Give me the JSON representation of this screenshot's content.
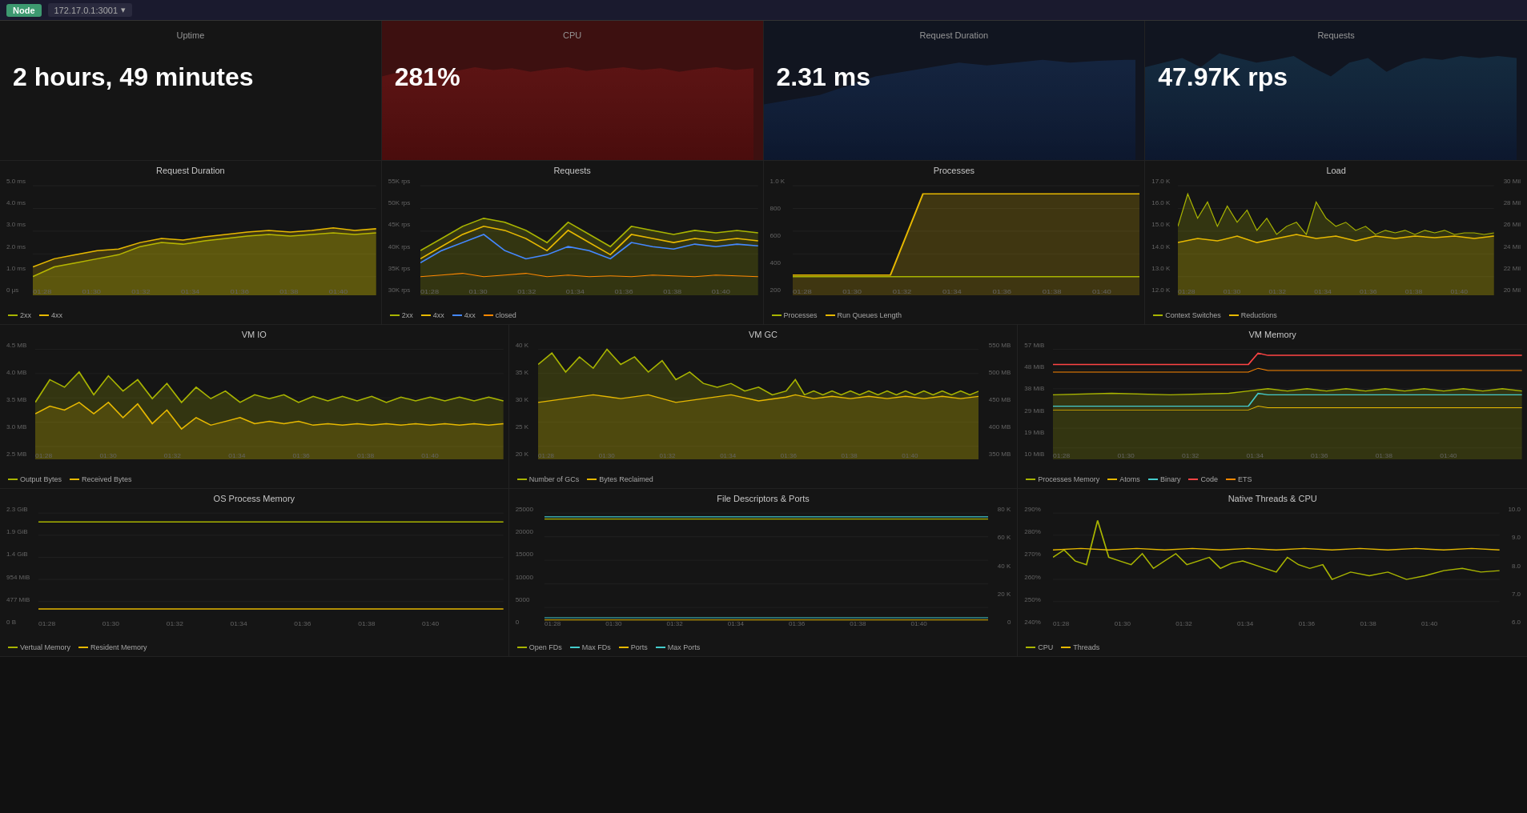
{
  "topbar": {
    "node_label": "Node",
    "address": "172.17.0.1:3001",
    "dropdown_arrow": "▾"
  },
  "summary": {
    "uptime": {
      "title": "Uptime",
      "value": "2 hours, 49 minutes"
    },
    "cpu": {
      "title": "CPU",
      "value": "281%"
    },
    "request_duration": {
      "title": "Request Duration",
      "value": "2.31 ms"
    },
    "requests": {
      "title": "Requests",
      "value": "47.97K rps"
    }
  },
  "charts_row1": {
    "request_duration": {
      "title": "Request Duration",
      "yaxis": [
        "5.0 ms",
        "4.0 ms",
        "3.0 ms",
        "2.0 ms",
        "1.0 ms",
        "0 μs"
      ],
      "xaxis": [
        "01:28",
        "01:30",
        "01:32",
        "01:34",
        "01:36",
        "01:38",
        "01:40"
      ],
      "legend": [
        {
          "label": "2xx",
          "color": "#a8b400"
        },
        {
          "label": "4xx",
          "color": "#e6b800"
        }
      ]
    },
    "requests": {
      "title": "Requests",
      "yaxis": [
        "55K rps",
        "50K rps",
        "45K rps",
        "40K rps",
        "35K rps",
        "30K rps"
      ],
      "xaxis": [
        "01:28",
        "01:30",
        "01:32",
        "01:34",
        "01:36",
        "01:38",
        "01:40"
      ],
      "legend": [
        {
          "label": "2xx",
          "color": "#a8b400"
        },
        {
          "label": "4xx",
          "color": "#e6b800"
        },
        {
          "label": "4xx",
          "color": "#4488ff"
        },
        {
          "label": "closed",
          "color": "#ff8800"
        }
      ]
    },
    "processes": {
      "title": "Processes",
      "yaxis": [
        "1.0 K",
        "800",
        "600",
        "400",
        "200"
      ],
      "xaxis": [
        "01:28",
        "01:30",
        "01:32",
        "01:34",
        "01:36",
        "01:38",
        "01:40"
      ],
      "legend": [
        {
          "label": "Processes",
          "color": "#a8b400"
        },
        {
          "label": "Run Queues Length",
          "color": "#e6b800"
        }
      ]
    },
    "load": {
      "title": "Load",
      "yaxis_left": [
        "17.0 K",
        "16.0 K",
        "15.0 K",
        "14.0 K",
        "13.0 K",
        "12.0 K"
      ],
      "yaxis_right": [
        "30 Mil",
        "28 Mil",
        "26 Mil",
        "24 Mil",
        "22 Mil",
        "20 Mil"
      ],
      "xaxis": [
        "01:28",
        "01:30",
        "01:32",
        "01:34",
        "01:36",
        "01:38",
        "01:40"
      ],
      "legend": [
        {
          "label": "Context Switches",
          "color": "#a8b400"
        },
        {
          "label": "Reductions",
          "color": "#e6b800"
        }
      ]
    }
  },
  "charts_row2": {
    "vm_io": {
      "title": "VM IO",
      "yaxis": [
        "4.5 MB",
        "4.0 MB",
        "3.5 MB",
        "3.0 MB",
        "2.5 MB"
      ],
      "xaxis": [
        "01:28",
        "01:30",
        "01:32",
        "01:34",
        "01:36",
        "01:38",
        "01:40"
      ],
      "legend": [
        {
          "label": "Output Bytes",
          "color": "#a8b400"
        },
        {
          "label": "Received Bytes",
          "color": "#e6b800"
        }
      ]
    },
    "vm_gc": {
      "title": "VM GC",
      "yaxis_left": [
        "40 K",
        "35 K",
        "30 K",
        "25 K",
        "20 K"
      ],
      "yaxis_right": [
        "550 MB",
        "500 MB",
        "450 MB",
        "400 MB",
        "350 MB"
      ],
      "xaxis": [
        "01:28",
        "01:30",
        "01:32",
        "01:34",
        "01:36",
        "01:38",
        "01:40"
      ],
      "legend": [
        {
          "label": "Number of GCs",
          "color": "#a8b400"
        },
        {
          "label": "Bytes Reclaimed",
          "color": "#e6b800"
        }
      ]
    },
    "vm_memory": {
      "title": "VM Memory",
      "yaxis": [
        "57 MiB",
        "48 MiB",
        "38 MiB",
        "29 MiB",
        "19 MiB",
        "10 MiB"
      ],
      "xaxis": [
        "01:28",
        "01:30",
        "01:32",
        "01:34",
        "01:36",
        "01:38",
        "01:40"
      ],
      "legend": [
        {
          "label": "Processes Memory",
          "color": "#a8b400"
        },
        {
          "label": "Atoms",
          "color": "#e6b800"
        },
        {
          "label": "Binary",
          "color": "#44cccc"
        },
        {
          "label": "Code",
          "color": "#ff4444"
        },
        {
          "label": "ETS",
          "color": "#ff8800"
        }
      ]
    }
  },
  "charts_row3": {
    "os_process_memory": {
      "title": "OS Process Memory",
      "yaxis": [
        "2.3 GiB",
        "1.9 GiB",
        "1.4 GiB",
        "954 MiB",
        "477 MiB",
        "0 B"
      ],
      "xaxis": [
        "01:28",
        "01:30",
        "01:32",
        "01:34",
        "01:36",
        "01:38",
        "01:40"
      ],
      "legend": [
        {
          "label": "Vertual Memory",
          "color": "#a8b400"
        },
        {
          "label": "Resident Memory",
          "color": "#e6b800"
        }
      ]
    },
    "file_descriptors": {
      "title": "File Descriptors & Ports",
      "yaxis_left": [
        "25000",
        "20000",
        "15000",
        "10000",
        "5000",
        "0"
      ],
      "yaxis_right": [
        "80 K",
        "60 K",
        "40 K",
        "20 K",
        "0"
      ],
      "xaxis": [
        "01:28",
        "01:30",
        "01:32",
        "01:34",
        "01:36",
        "01:38",
        "01:40"
      ],
      "legend": [
        {
          "label": "Open FDs",
          "color": "#a8b400"
        },
        {
          "label": "Max FDs",
          "color": "#44cccc"
        },
        {
          "label": "Ports",
          "color": "#e6b800"
        },
        {
          "label": "Max Ports",
          "color": "#44cccc"
        }
      ]
    },
    "native_threads": {
      "title": "Native Threads & CPU",
      "yaxis_left": [
        "290%",
        "280%",
        "270%",
        "260%",
        "250%",
        "240%"
      ],
      "yaxis_right": [
        "10.0",
        "9.0",
        "8.0",
        "7.0",
        "6.0"
      ],
      "xaxis": [
        "01:28",
        "01:30",
        "01:32",
        "01:34",
        "01:36",
        "01:38",
        "01:40"
      ],
      "legend": [
        {
          "label": "CPU",
          "color": "#a8b400"
        },
        {
          "label": "Threads",
          "color": "#e6b800"
        }
      ]
    }
  }
}
